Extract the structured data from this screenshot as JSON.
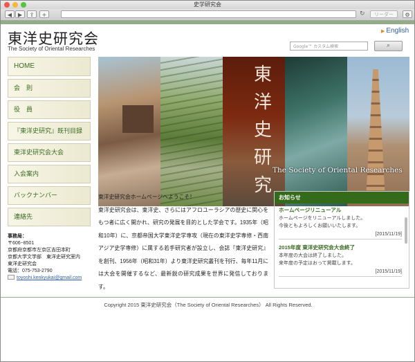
{
  "browser": {
    "window_title": "史学研究会",
    "reader_label": "リーダー"
  },
  "header": {
    "site_title": "東洋史研究会",
    "site_subtitle": "The Society of Oriental Researches",
    "english_link": "English",
    "search_placeholder": "Google™ カスタム検索",
    "search_button_icon": "search-icon"
  },
  "nav": {
    "items": [
      {
        "label": "HOME"
      },
      {
        "label": "会　則"
      },
      {
        "label": "役　員"
      },
      {
        "label": "『東洋史研究』既刊目録"
      },
      {
        "label": "東洋史研究会大会"
      },
      {
        "label": "入会案内"
      },
      {
        "label": "バックナンバー"
      },
      {
        "label": "連絡先"
      }
    ]
  },
  "office": {
    "label": "事務局：",
    "postal": "〒606−8501",
    "address1": "京都府京都市左京区吉田本町",
    "address2": "京都大学文学部　東洋史研究室内",
    "org": "東洋史研究会",
    "phone": "電話：075-753-2790",
    "email": "toyoshi.kenkyukai@gmail.com"
  },
  "hero": {
    "calligraphy": [
      "東",
      "洋",
      "史",
      "研",
      "究"
    ],
    "caption": "The Society of Oriental Researches"
  },
  "intro": {
    "greeting": "東洋史研究会ホームページへようこそ！",
    "body": "東洋史研究会は、東洋史、さらにはアフロユーラシアの歴史に関心をもつ者に広く開かれ、研究の発展を目的とした学会です。1935年（昭和10年）に、京都帝国大学東洋史学専攻（現在の東洋史学専修・西南アジア史学専修）に属する若手研究者が設立し、会誌『東洋史研究』を創刊、1956年（昭和31年）より東洋史研究叢刊を刊行、毎年11月には大会を開催するなど、最新鋭の研究成果を世界に発信しております。"
  },
  "news": {
    "heading": "お知らせ",
    "items": [
      {
        "title": "ホームページリニューアル",
        "lines": [
          "ホームページをリニューアルしました。",
          "今後ともよろしくお願いいたします。"
        ],
        "date": "[2015/11/19]"
      },
      {
        "title": "2015年度 東洋史研究会大会終了",
        "lines": [
          "本年度の大会は終了しました。",
          "来年度の予定はおって掲載します。"
        ],
        "date": "[2015/11/19]"
      }
    ]
  },
  "footer": {
    "copyright": "Copyright 2015 東洋史研究会（The Society of Oriental Researches） All Rights Reserved."
  }
}
